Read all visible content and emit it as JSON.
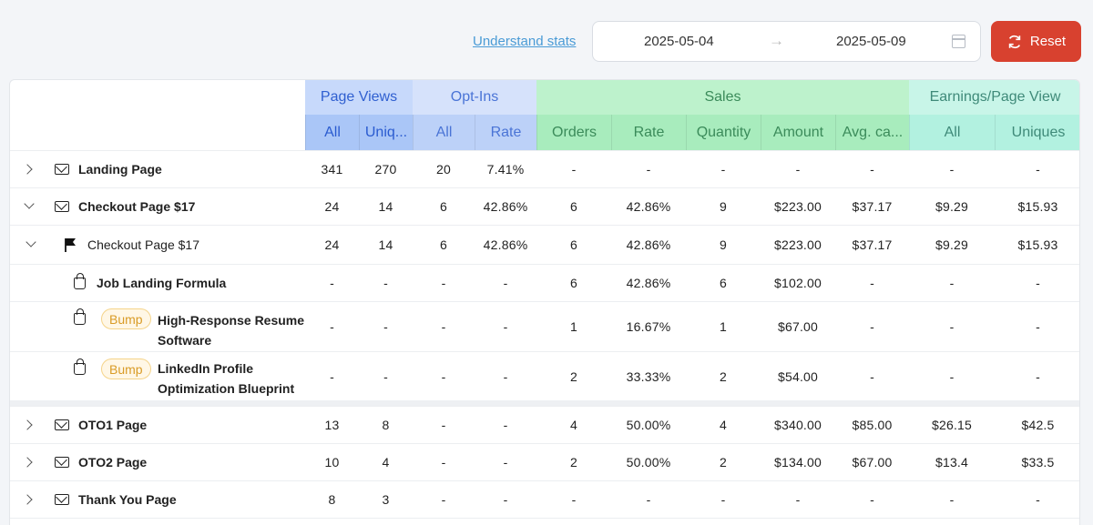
{
  "toolbar": {
    "understand_label": "Understand stats",
    "start_date": "2025-05-04",
    "end_date": "2025-05-09",
    "reset_label": "Reset",
    "reset_color": "#d8412f"
  },
  "table": {
    "groups": [
      {
        "label": "Page Views"
      },
      {
        "label": "Opt-Ins"
      },
      {
        "label": "Sales"
      },
      {
        "label": "Earnings/Page View"
      }
    ],
    "subheaders": [
      "All",
      "Uniq...",
      "All",
      "Rate",
      "Orders",
      "Rate",
      "Quantity",
      "Amount",
      "Avg. ca...",
      "All",
      "Uniques"
    ],
    "rows": [
      {
        "name": "Landing Page",
        "values": [
          "341",
          "270",
          "20",
          "7.41%",
          "-",
          "-",
          "-",
          "-",
          "-",
          "-",
          "-"
        ]
      },
      {
        "name": "Checkout Page $17",
        "values": [
          "24",
          "14",
          "6",
          "42.86%",
          "6",
          "42.86%",
          "9",
          "$223.00",
          "$37.17",
          "$9.29",
          "$15.93"
        ]
      },
      {
        "name": "Checkout Page $17",
        "values": [
          "24",
          "14",
          "6",
          "42.86%",
          "6",
          "42.86%",
          "9",
          "$223.00",
          "$37.17",
          "$9.29",
          "$15.93"
        ]
      },
      {
        "name": "Job Landing Formula",
        "values": [
          "-",
          "-",
          "-",
          "-",
          "6",
          "42.86%",
          "6",
          "$102.00",
          "-",
          "-",
          "-"
        ]
      },
      {
        "badge": "Bump",
        "name_line1": "High-Response Resume",
        "name_line2": "Software",
        "values": [
          "-",
          "-",
          "-",
          "-",
          "1",
          "16.67%",
          "1",
          "$67.00",
          "-",
          "-",
          "-"
        ]
      },
      {
        "badge": "Bump",
        "name_line1": "LinkedIn Profile",
        "name_line2": "Optimization Blueprint",
        "values": [
          "-",
          "-",
          "-",
          "-",
          "2",
          "33.33%",
          "2",
          "$54.00",
          "-",
          "-",
          "-"
        ]
      },
      {
        "name": "OTO1 Page",
        "values": [
          "13",
          "8",
          "-",
          "-",
          "4",
          "50.00%",
          "4",
          "$340.00",
          "$85.00",
          "$26.15",
          "$42.5"
        ]
      },
      {
        "name": "OTO2 Page",
        "values": [
          "10",
          "4",
          "-",
          "-",
          "2",
          "50.00%",
          "2",
          "$134.00",
          "$67.00",
          "$13.4",
          "$33.5"
        ]
      },
      {
        "name": "Thank You Page",
        "values": [
          "8",
          "3",
          "-",
          "-",
          "-",
          "-",
          "-",
          "-",
          "-",
          "-",
          "-"
        ]
      }
    ]
  },
  "icons": {
    "mail": "mail-icon",
    "flag": "flag-icon",
    "bag": "shopping-bag-icon",
    "calendar": "calendar-icon",
    "refresh": "refresh-icon",
    "arrow": "arrow-right-icon"
  }
}
